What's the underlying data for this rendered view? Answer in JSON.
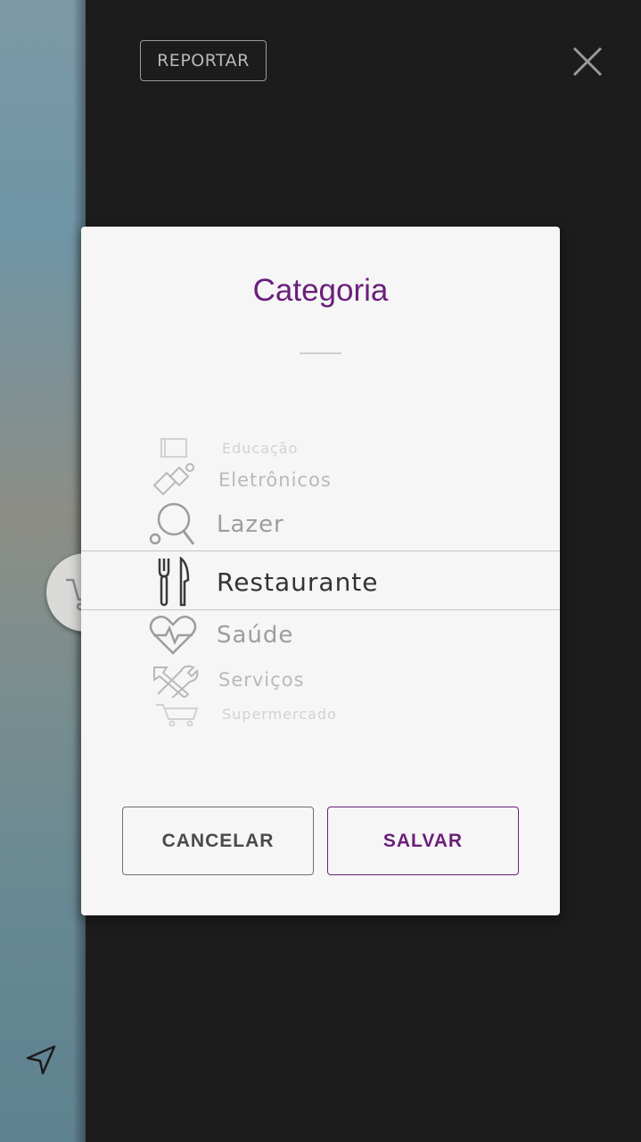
{
  "header": {
    "report_label": "REPORTAR"
  },
  "dialog": {
    "title": "Categoria",
    "categories": [
      {
        "label": "Educação",
        "icon": "book-icon"
      },
      {
        "label": "Eletrônicos",
        "icon": "usb-plug-icon"
      },
      {
        "label": "Lazer",
        "icon": "ping-pong-icon"
      },
      {
        "label": "Restaurante",
        "icon": "fork-knife-icon",
        "selected": true
      },
      {
        "label": "Saúde",
        "icon": "heart-pulse-icon"
      },
      {
        "label": "Serviços",
        "icon": "tools-icon"
      },
      {
        "label": "Supermercado",
        "icon": "cart-icon"
      }
    ],
    "cancel_label": "CANCELAR",
    "save_label": "SALVAR"
  },
  "colors": {
    "accent": "#6a1f7a",
    "overlay": "#1c1c1c",
    "dialog_bg": "#f6f6f6"
  }
}
